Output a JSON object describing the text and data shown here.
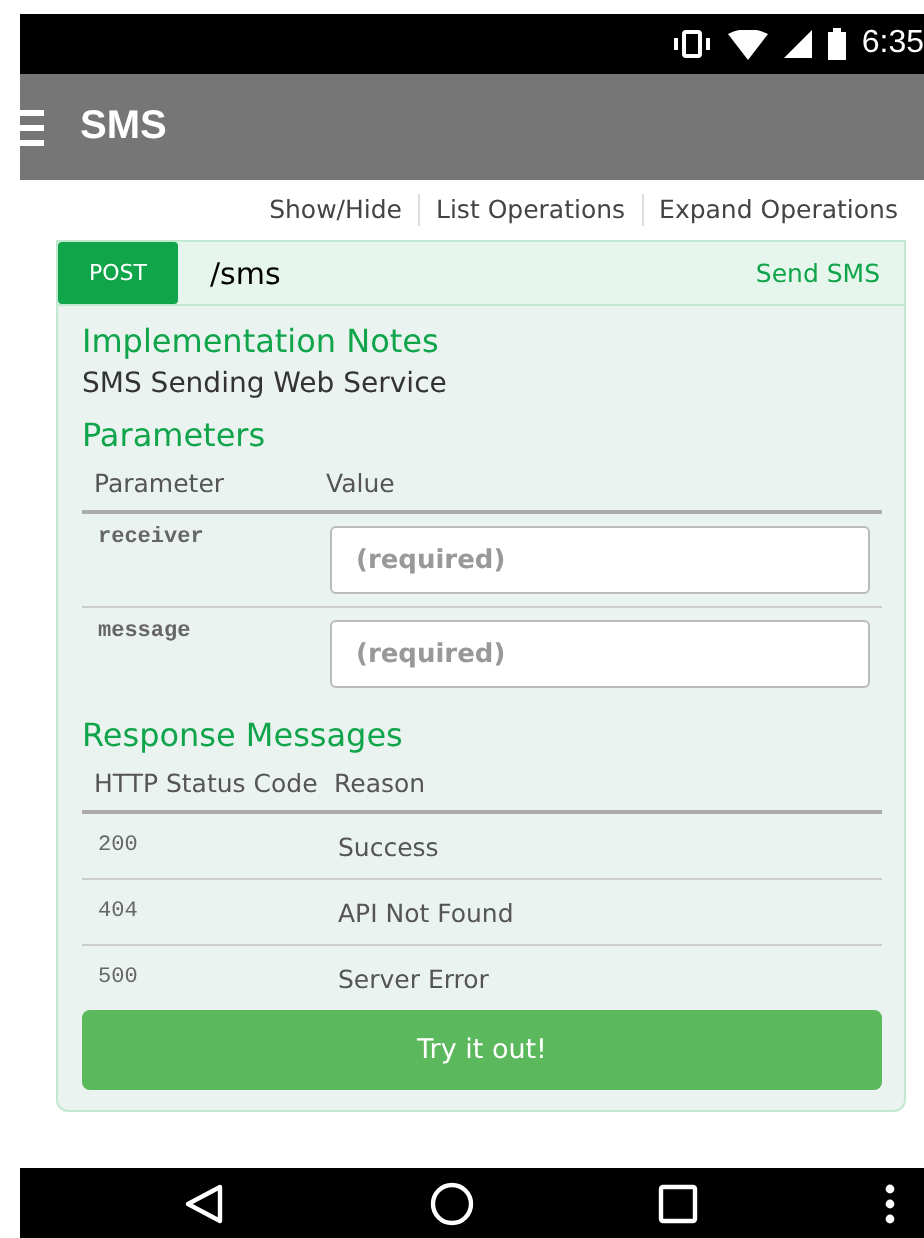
{
  "status_bar": {
    "time": "6:35"
  },
  "app_bar": {
    "title": "SMS"
  },
  "links": [
    "Show/Hide",
    "List Operations",
    "Expand Operations"
  ],
  "operation": {
    "method": "POST",
    "path": "/sms",
    "summary": "Send SMS",
    "notes_heading": "Implementation Notes",
    "notes": "SMS Sending Web Service",
    "parameters_heading": "Parameters",
    "parameter_columns": [
      "Parameter",
      "Value"
    ],
    "parameters": [
      {
        "name": "receiver",
        "placeholder": "(required)"
      },
      {
        "name": "message",
        "placeholder": "(required)"
      }
    ],
    "responses_heading": "Response Messages",
    "response_columns": [
      "HTTP Status Code",
      "Reason"
    ],
    "responses": [
      {
        "code": "200",
        "reason": "Success"
      },
      {
        "code": "404",
        "reason": "API Not Found"
      },
      {
        "code": "500",
        "reason": "Server Error"
      }
    ],
    "submit": "Try it out!"
  }
}
